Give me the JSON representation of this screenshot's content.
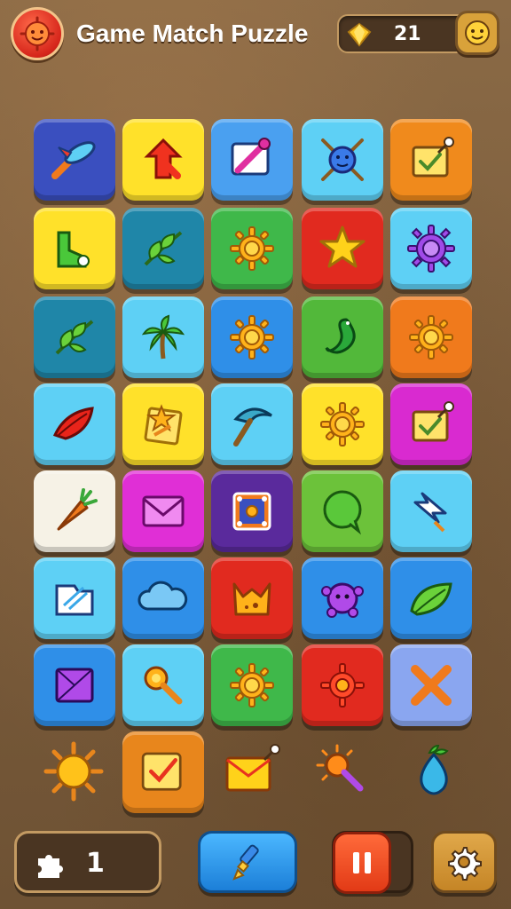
{
  "header": {
    "title": "Game Match Puzzle",
    "gem_count": "21"
  },
  "footer": {
    "lives_count": "1"
  },
  "grid": {
    "rows": [
      [
        {
          "icon": "rocket-plane-icon",
          "color": "#3a4fbf"
        },
        {
          "icon": "arrow-signpost-icon",
          "color": "#ffe12a"
        },
        {
          "icon": "paint-pen-icon",
          "color": "#4aa0f0"
        },
        {
          "icon": "crossed-swords-face-icon",
          "color": "#5ed0f5"
        },
        {
          "icon": "checkbox-pin-icon",
          "color": "#f08a1c"
        }
      ],
      [
        {
          "icon": "boot-icon",
          "color": "#ffe12a"
        },
        {
          "icon": "palm-leaf-icon",
          "color": "#1f86a8"
        },
        {
          "icon": "sun-gear-icon",
          "color": "#3fb84a"
        },
        {
          "icon": "star-icon",
          "color": "#e12a1f"
        },
        {
          "icon": "purple-gear-icon",
          "color": "#5ed0f5"
        }
      ],
      [
        {
          "icon": "palm-leaf-icon",
          "color": "#1f86a8"
        },
        {
          "icon": "palm-tree-icon",
          "color": "#5ed0f5"
        },
        {
          "icon": "sun-gear-icon",
          "color": "#2f8fe8"
        },
        {
          "icon": "snake-icon",
          "color": "#52b83a"
        },
        {
          "icon": "sun-gear-icon",
          "color": "#f07a1c"
        }
      ],
      [
        {
          "icon": "red-leaf-icon",
          "color": "#5ed0f5"
        },
        {
          "icon": "star-note-icon",
          "color": "#ffe12a"
        },
        {
          "icon": "pickaxe-icon",
          "color": "#5ed0f5"
        },
        {
          "icon": "sun-gear-icon",
          "color": "#ffe12a"
        },
        {
          "icon": "checkbox-pin-icon",
          "color": "#d92ad0"
        }
      ],
      [
        {
          "icon": "carrot-icon",
          "color": "#f6f2e6"
        },
        {
          "icon": "envelope-icon",
          "color": "#e02fd6"
        },
        {
          "icon": "target-frame-icon",
          "color": "#5a2a9c"
        },
        {
          "icon": "speech-bubble-icon",
          "color": "#6cc23a"
        },
        {
          "icon": "arrow-cursor-icon",
          "color": "#5ed0f5"
        }
      ],
      [
        {
          "icon": "folder-doc-icon",
          "color": "#5ed0f5"
        },
        {
          "icon": "cloud-icon",
          "color": "#2f8fe8"
        },
        {
          "icon": "fox-face-icon",
          "color": "#e12a1f"
        },
        {
          "icon": "purple-monster-icon",
          "color": "#2f8fe8"
        },
        {
          "icon": "green-leaf-icon",
          "color": "#2f8fe8"
        }
      ],
      [
        {
          "icon": "purple-envelope-icon",
          "color": "#2f8fe8"
        },
        {
          "icon": "magnifier-key-icon",
          "color": "#5ed0f5"
        },
        {
          "icon": "sun-gear-icon",
          "color": "#3fb84a"
        },
        {
          "icon": "red-gear-icon",
          "color": "#e12a1f"
        },
        {
          "icon": "cross-x-icon",
          "color": "#8aa6f0"
        }
      ]
    ],
    "loose": [
      {
        "icon": "sun-icon"
      },
      {
        "icon": "checkbox-icon",
        "color": "#e8861c"
      },
      {
        "icon": "envelope-pin-icon"
      },
      {
        "icon": "sun-wand-icon"
      },
      {
        "icon": "blue-drop-icon"
      }
    ]
  }
}
